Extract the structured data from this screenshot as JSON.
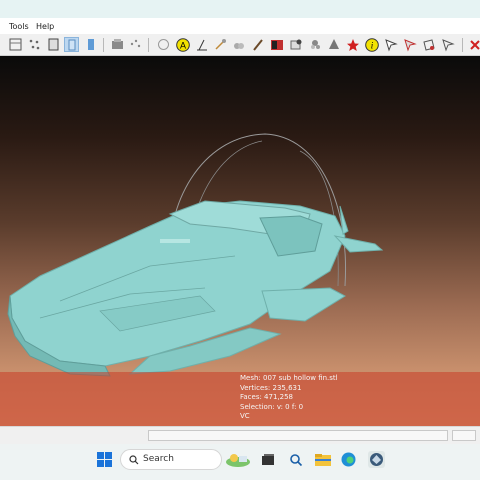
{
  "menu": {
    "tools": "Tools",
    "help": "Help"
  },
  "toolbar": {
    "icons": [
      "mesh-layer-icon",
      "dots-icon",
      "trim-icon",
      "sort-icon",
      "color-bar-icon",
      "filter-icon",
      "sphere-icon",
      "info-a-icon",
      "measure-icon",
      "shovel-icon",
      "scissors-icon",
      "brush-icon",
      "split-icon",
      "stamp-icon",
      "flower-icon",
      "star-icon",
      "info-i-icon",
      "select-faces-icon",
      "select-vertices-icon",
      "select-conn-icon",
      "close-red-icon"
    ]
  },
  "info_panel": {
    "mesh": "Mesh: 007 sub hollow fin.stl",
    "vertices": "Vertices: 235,631",
    "faces": "Faces: 471,258",
    "selection": "Selection: v: 0 f: 0",
    "vc": "VC"
  },
  "taskbar": {
    "search_placeholder": "Search"
  },
  "colors": {
    "mesh": "#8fd3cf",
    "selection_overlay": "#c83c28",
    "bg_top": "#0a0a0a",
    "bg_bottom": "#d79a72"
  }
}
